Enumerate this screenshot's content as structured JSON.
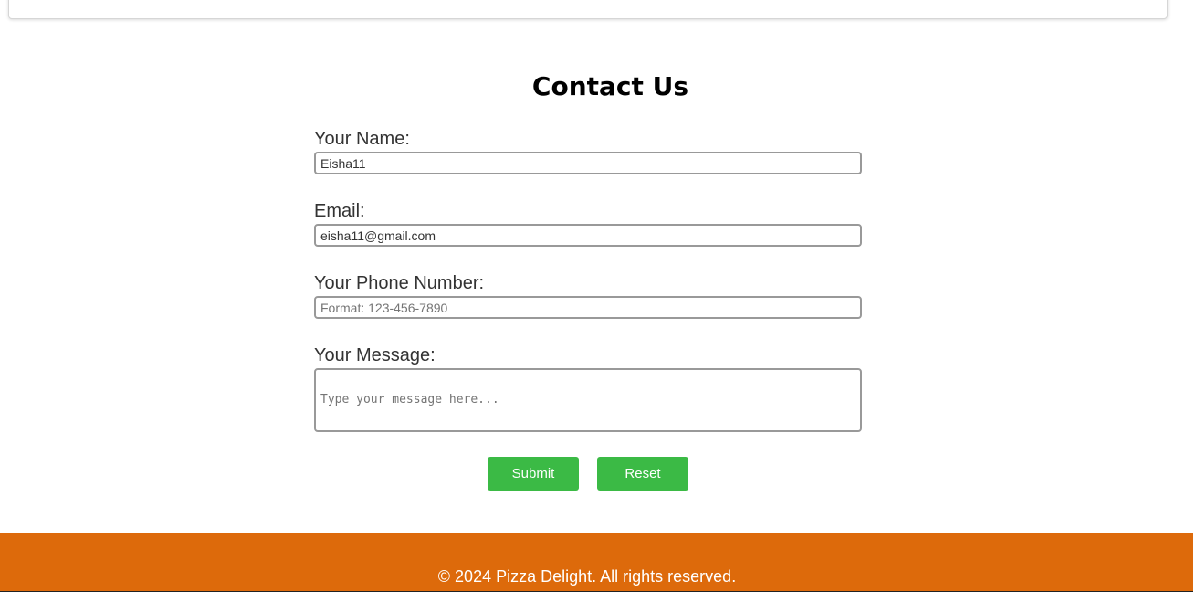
{
  "contact": {
    "title": "Contact Us",
    "name_label": "Your Name:",
    "name_value": "Eisha11",
    "email_label": "Email:",
    "email_value": "eisha11@gmail.com",
    "phone_label": "Your Phone Number:",
    "phone_placeholder": "Format: 123-456-7890",
    "message_label": "Your Message:",
    "message_placeholder": "Type your message here...",
    "submit_label": "Submit",
    "reset_label": "Reset"
  },
  "footer": {
    "text": "© 2024 Pizza Delight. All rights reserved."
  },
  "colors": {
    "button": "#3bba45",
    "footer": "#dd6a0b"
  }
}
